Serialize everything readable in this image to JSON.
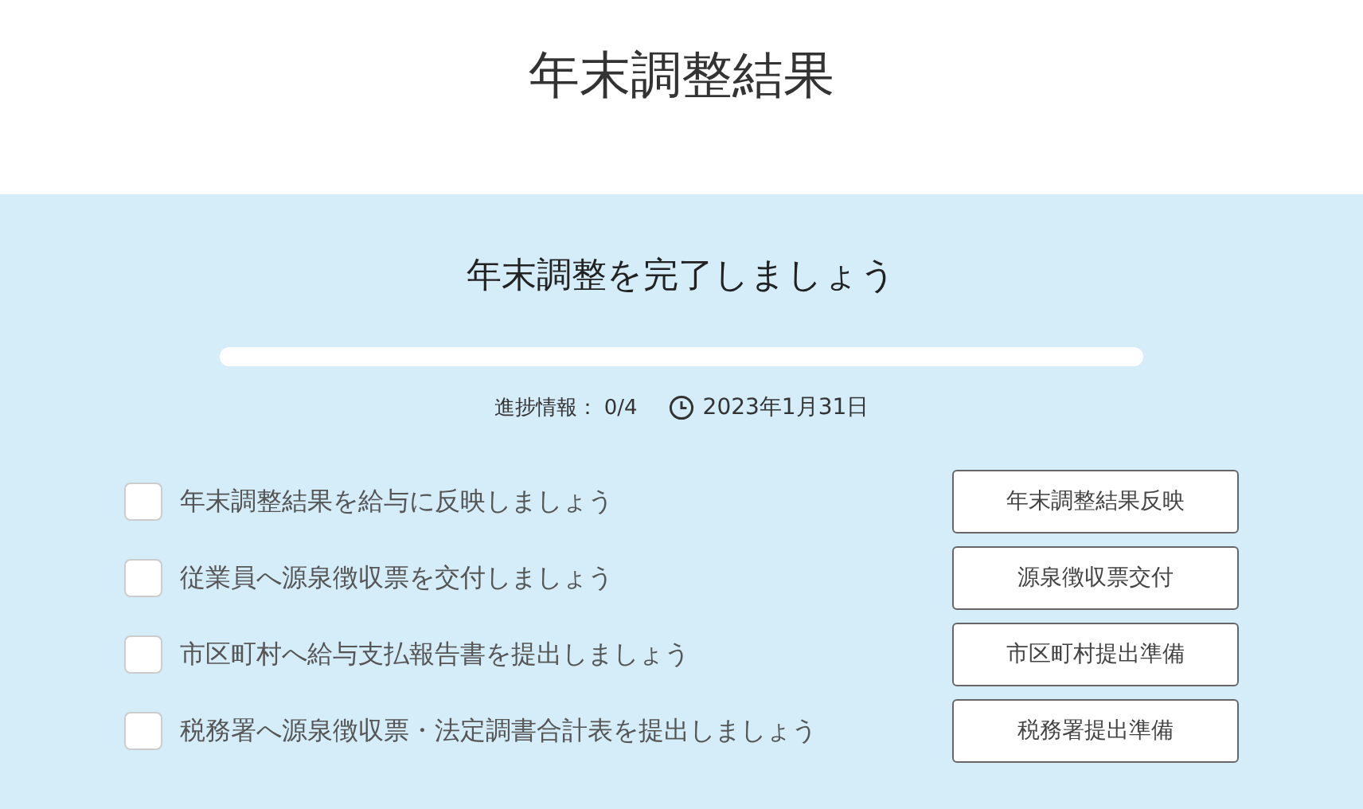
{
  "page_title": "年末調整結果",
  "panel": {
    "heading": "年末調整を完了しましょう",
    "progress": {
      "level": 0
    },
    "progress_label": "進捗情報：",
    "progress_count": "0/4",
    "deadline": "2023年1月31日",
    "tasks": [
      {
        "label": "年末調整結果を給与に反映しましょう",
        "checked": false,
        "button": "年末調整結果反映"
      },
      {
        "label": "従業員へ源泉徴収票を交付しましょう",
        "checked": false,
        "button": "源泉徴収票交付"
      },
      {
        "label": "市区町村へ給与支払報告書を提出しましょう",
        "checked": false,
        "button": "市区町村提出準備"
      },
      {
        "label": "税務署へ源泉徴収票・法定調書合計表を提出しましょう",
        "checked": false,
        "button": "税務署提出準備"
      }
    ]
  }
}
